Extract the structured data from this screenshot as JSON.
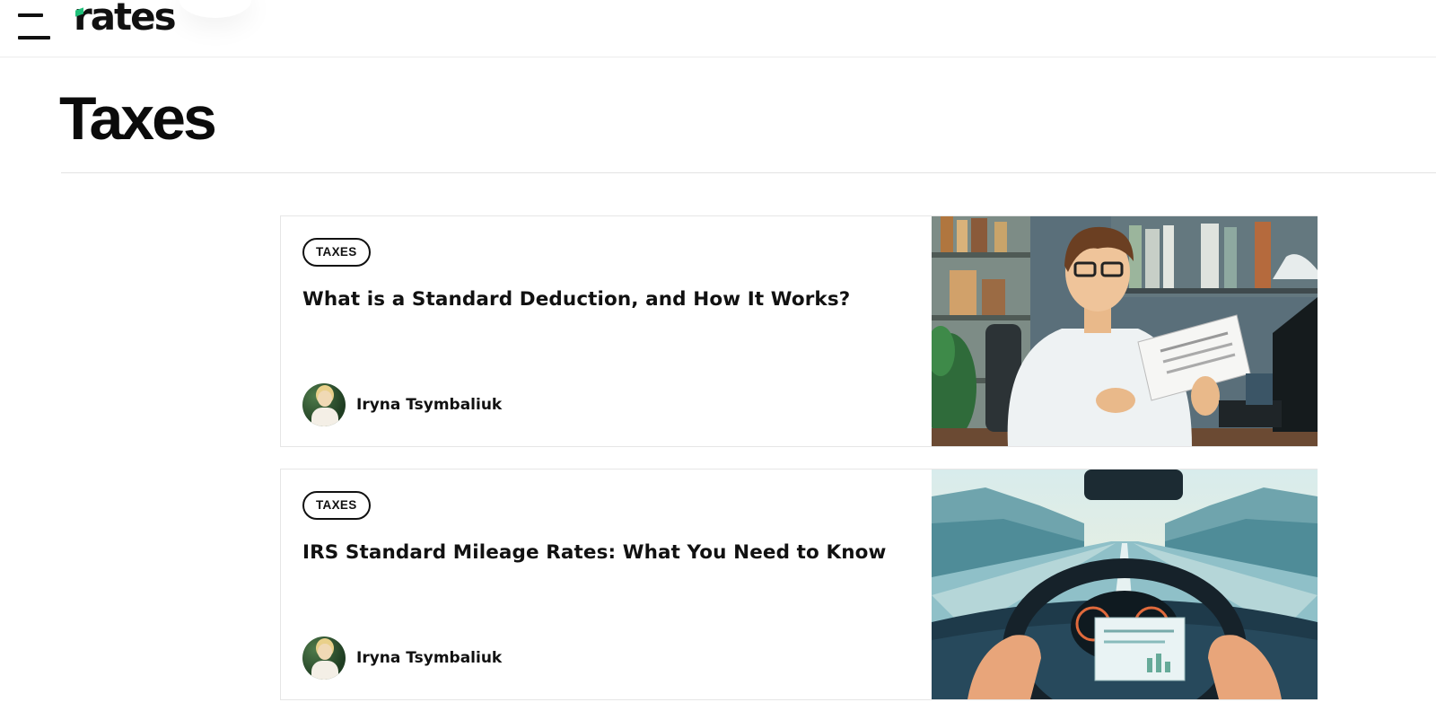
{
  "header": {
    "logo_text": "rates",
    "menu_icon": "hamburger-menu-icon",
    "logo_accent_color": "#21c07a"
  },
  "page": {
    "title": "Taxes"
  },
  "articles": [
    {
      "category": "TAXES",
      "title": "What is a Standard Deduction, and How It Works?",
      "author": "Iryna Tsymbaliuk",
      "image": "man-reviewing-tax-document-illustration"
    },
    {
      "category": "TAXES",
      "title": "IRS Standard Mileage Rates: What You Need to Know",
      "author": "Iryna Tsymbaliuk",
      "image": "car-dashboard-road-illustration"
    }
  ]
}
